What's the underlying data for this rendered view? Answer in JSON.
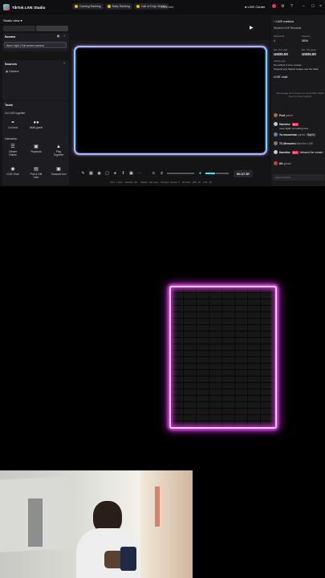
{
  "app": {
    "title": "TikTok LIVE Studio"
  },
  "header": {
    "tags": [
      "Gaming Ranking",
      "Daily Ranking",
      "Call of Duty: Mobile"
    ],
    "center_label": "LIVE info",
    "live_center": "LIVE Center"
  },
  "studio_view": {
    "label": "Studio view",
    "scenes_title": "Scenes",
    "scene_name": "Neon Light | Full screen camera",
    "sources_title": "Sources",
    "source_name": "Camera",
    "tools_title": "Tools",
    "go_live_together": "Go LIVE together",
    "cohost": "Co-host",
    "multi_guest": "Multi-guest",
    "interaction_title": "Interaction",
    "tools": [
      "Viewer Ranks",
      "Playbook",
      "Play Together",
      "LIVE Goal",
      "Poll & Gift Vote",
      "Treasure box"
    ]
  },
  "controls": {
    "timer": "00:17:57",
    "stats": [
      "CPU: 1.30%",
      "Network: 0%",
      "Upload: 140 kbps",
      "Dropped frames: 0",
      "Encoder: VP8, 60",
      "FPS: 30"
    ]
  },
  "live_metrics": {
    "title": "LIVE metrics",
    "student_rewards": "Student LIVE Rewards",
    "diamonds_label": "Diamonds",
    "diamonds_value": "0",
    "viewers_label": "Viewers",
    "viewers_value": "36%",
    "est_label_1": "Est. this LIVE",
    "est_value_1": "USD0.00",
    "est_label_2": "Est. this week",
    "est_value_2": "USD0.00",
    "activity_title": "Activity type",
    "activity_line_1": "Go LIVE for 3 more minutes",
    "activity_line_2": "Suspend your highest League over the week"
  },
  "live_chat": {
    "title": "LIVE chat",
    "prompt": "Encourage your viewers to send Gifts, thank them for their support",
    "messages": [
      {
        "user": "Poet",
        "text": "joined",
        "badge": ""
      },
      {
        "user": "Hamidse",
        "text": "neon lights of nothing new",
        "badge": "No.1"
      },
      {
        "user": "Yo.mouseman",
        "text": "joined",
        "badge": "",
        "extra": "Say hi"
      },
      {
        "user": "TC.Memories",
        "text": "liked the LIVE",
        "badge": ""
      },
      {
        "user": "Hamidse",
        "text": "followed the creator",
        "badge": "No.1"
      },
      {
        "user": "DK",
        "text": "joined",
        "badge": ""
      }
    ],
    "input_placeholder": "Add comment"
  },
  "colors": {
    "accent": "#fe2c55",
    "cyan": "#25f4ee",
    "neon_pink": "#d24ad8"
  }
}
